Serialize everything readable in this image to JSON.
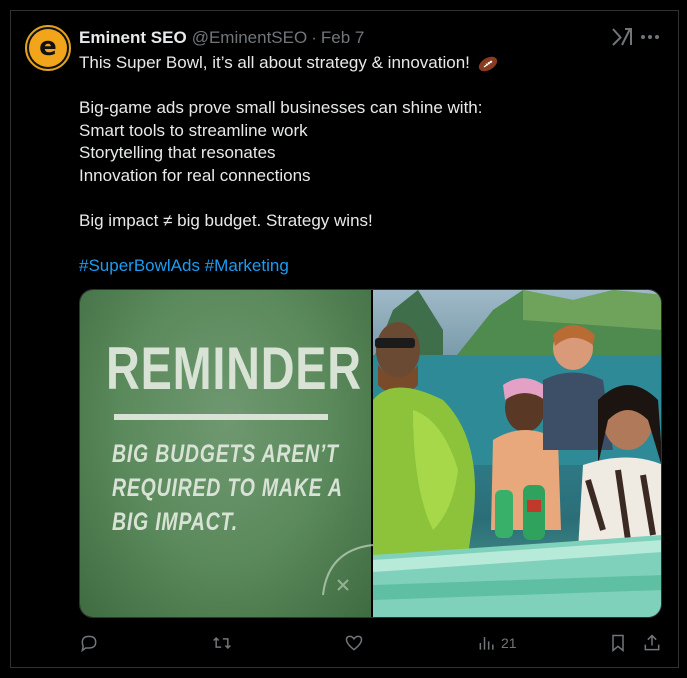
{
  "tweet": {
    "author_name": "Eminent SEO",
    "handle": "@EminentSEO",
    "separator": "·",
    "date": "Feb 7",
    "avatar_letter": "e",
    "text_lines": [
      "This Super Bowl, it’s all about strategy & innovation!",
      "",
      "Big-game ads prove small businesses can shine with:",
      "Smart tools to streamline work",
      "Storytelling that resonates",
      "Innovation for real connections",
      "",
      "Big impact ≠ big budget. Strategy wins!",
      ""
    ],
    "hashtags": [
      "#SuperBowlAds",
      "#Marketing"
    ],
    "icons": {
      "grok": "grok-icon",
      "more": "more-icon",
      "reply": "reply-icon",
      "retweet": "retweet-icon",
      "like": "like-icon",
      "views": "views-icon",
      "bookmark": "bookmark-icon",
      "share": "share-icon",
      "emoji": "football-icon"
    }
  },
  "media": {
    "left_image": {
      "heading": "REMINDER",
      "lines": [
        "BIG BUDGETS AREN’T",
        "REQUIRED TO MAKE A",
        "BIG IMPACT."
      ]
    },
    "right_image": {
      "description_icon": "boat-scene"
    }
  },
  "stats": {
    "views": "21"
  },
  "colors": {
    "background": "#000000",
    "text": "#e7e9ea",
    "muted": "#71767b",
    "link": "#1d9bf0",
    "border": "#2f3336",
    "field_green": "#5b8a5c"
  }
}
